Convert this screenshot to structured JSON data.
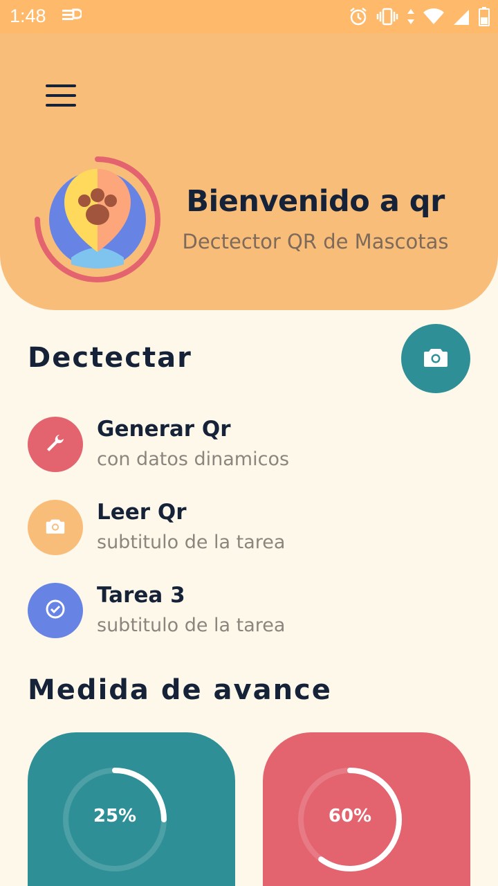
{
  "status_bar": {
    "time": "1:48",
    "icons": [
      "cast-icon",
      "alarm-icon",
      "vibrate-icon",
      "wifi-icon",
      "signal-icon",
      "battery-icon"
    ]
  },
  "header": {
    "title": "Bienvenido a qr",
    "subtitle": "Dectector QR de Mascotas"
  },
  "detect": {
    "title": "Dectectar",
    "tasks": [
      {
        "title": "Generar Qr",
        "subtitle": "con datos dinamicos",
        "icon": "wrench-icon",
        "color": "#e3636f"
      },
      {
        "title": "Leer Qr",
        "subtitle": "subtitulo de la tarea",
        "icon": "camera-icon",
        "color": "#f9bd7a"
      },
      {
        "title": "Tarea 3",
        "subtitle": "subtitulo de la tarea",
        "icon": "check-circle-icon",
        "color": "#6784e5"
      }
    ]
  },
  "progress": {
    "title": "Medida de avance",
    "cards": [
      {
        "percent_label": "25%",
        "value": 0.25,
        "color": "#2e9096"
      },
      {
        "percent_label": "60%",
        "value": 0.6,
        "color": "#e3636f"
      }
    ]
  },
  "colors": {
    "accent_orange": "#f9bd7a",
    "status_orange": "#ffb96b",
    "teal": "#2e9096",
    "red": "#e3636f",
    "blue": "#6784e5",
    "navy": "#152238",
    "background": "#fdf8ea"
  }
}
